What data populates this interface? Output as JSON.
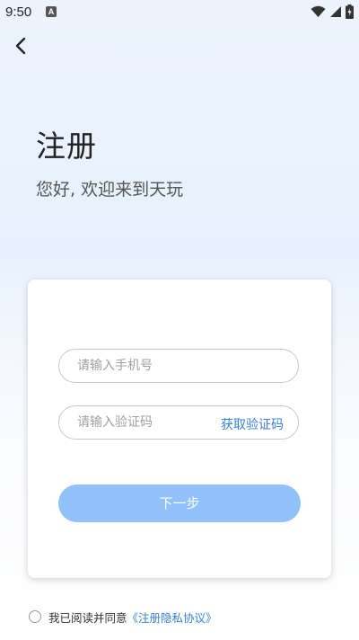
{
  "status_bar": {
    "time": "9:50",
    "notification_icon": "A",
    "icons": [
      "wifi-icon",
      "cellular-signal-icon",
      "battery-charging-icon"
    ]
  },
  "header": {
    "back_icon": "chevron-left-icon"
  },
  "hero": {
    "title": "注册",
    "subtitle": "您好, 欢迎来到天玩"
  },
  "form": {
    "phone_placeholder": "请输入手机号",
    "phone_value": "",
    "code_placeholder": "请输入验证码",
    "code_value": "",
    "get_code_label": "获取验证码",
    "next_label": "下一步"
  },
  "agreement": {
    "checked": false,
    "text": "我已阅读并同意",
    "link_label": "《注册隐私协议》"
  },
  "colors": {
    "accent": "#3b7fd6",
    "button": "#92c0fa",
    "background_top": "#ecf3fd"
  }
}
